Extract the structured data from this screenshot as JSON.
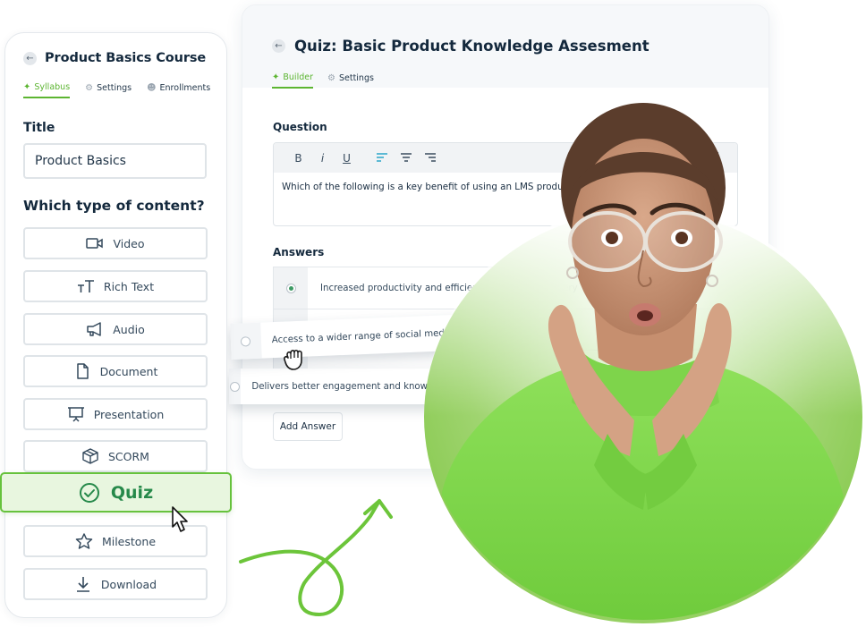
{
  "course": {
    "title": "Product Basics Course",
    "tabs": [
      {
        "label": "Syllabus",
        "icon": "magic-wand-icon",
        "active": true
      },
      {
        "label": "Settings",
        "icon": "gear-icon",
        "active": false
      },
      {
        "label": "Enrollments",
        "icon": "users-icon",
        "active": false
      }
    ],
    "title_label": "Title",
    "title_value": "Product Basics",
    "content_type_label": "Which type of content?",
    "content_types": [
      {
        "label": "Video",
        "icon": "video-icon"
      },
      {
        "label": "Rich Text",
        "icon": "text-size-icon"
      },
      {
        "label": "Audio",
        "icon": "megaphone-icon"
      },
      {
        "label": "Document",
        "icon": "document-icon"
      },
      {
        "label": "Presentation",
        "icon": "presentation-icon"
      },
      {
        "label": "SCORM",
        "icon": "package-icon"
      },
      {
        "label": "Quiz",
        "icon": "check-circle-icon",
        "selected": true
      },
      {
        "label": "Milestone",
        "icon": "star-icon"
      },
      {
        "label": "Download",
        "icon": "download-icon"
      }
    ]
  },
  "quiz": {
    "title": "Quiz: Basic Product Knowledge Assesment",
    "tabs": [
      {
        "label": "Builder",
        "icon": "magic-wand-icon",
        "active": true
      },
      {
        "label": "Settings",
        "icon": "gear-icon",
        "active": false
      }
    ],
    "question_label": "Question",
    "toolbar": {
      "bold": "B",
      "italic": "i",
      "underline": "U",
      "more": "⋮"
    },
    "question_text": "Which of the following is a key benefit of using an LMS product?",
    "answers_label": "Answers",
    "answers": [
      {
        "text": "Increased productivity and efficiency in training delivery",
        "selected": true
      },
      {
        "text": "Access to a wider range of social media platforms",
        "selected": false,
        "dragging": true
      },
      {
        "text": "Delivers better engagement and knowledge retention",
        "selected": false
      }
    ],
    "add_answer_label": "Add Answer"
  },
  "colors": {
    "accent_green": "#5cb531",
    "quiz_highlight_bg": "#e8f6df",
    "quiz_text": "#26894a",
    "heading": "#14293d"
  }
}
